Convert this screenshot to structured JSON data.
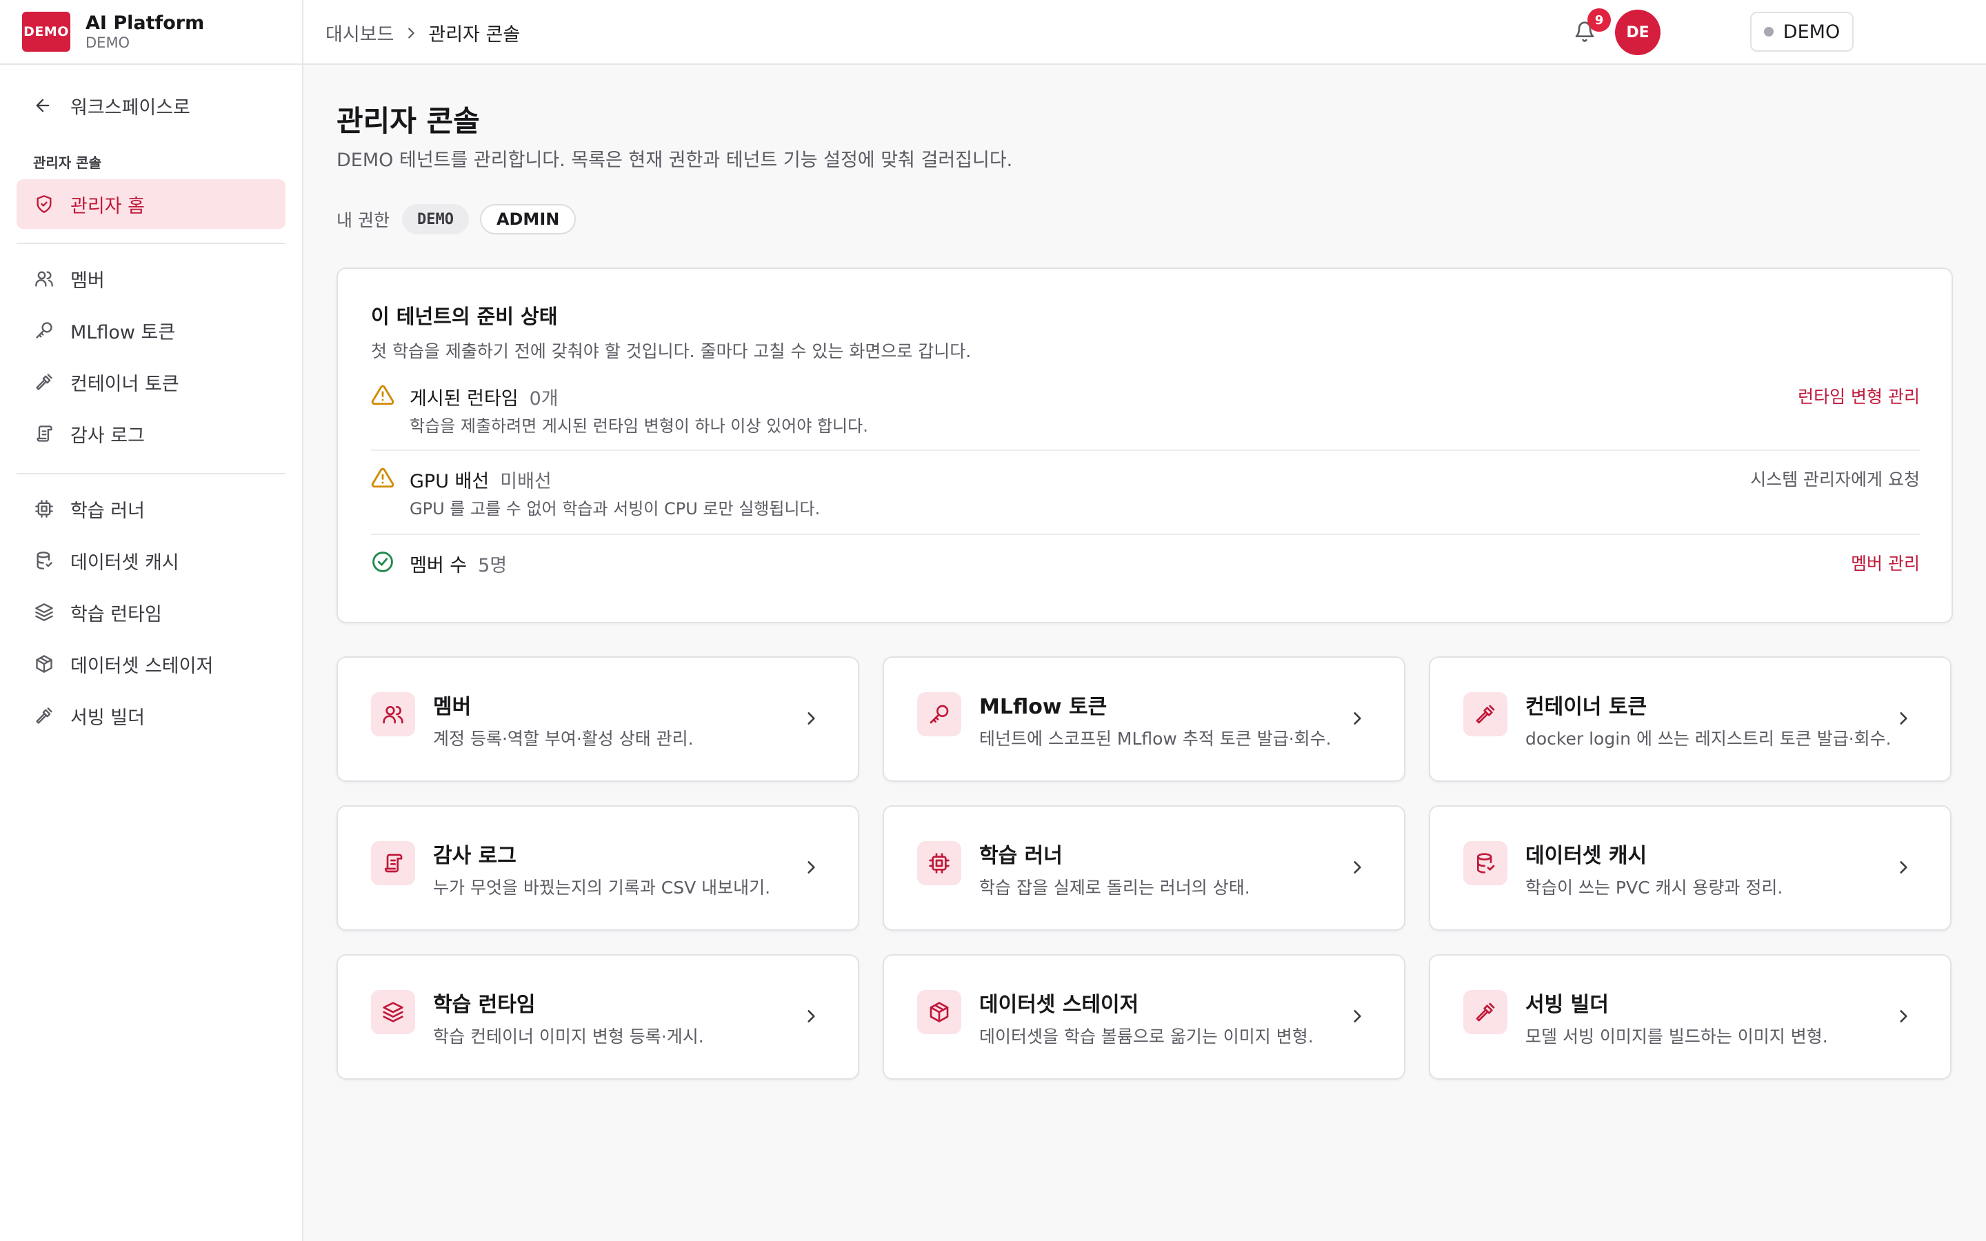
{
  "brand": {
    "logo": "DEMO",
    "name": "AI Platform",
    "tenant": "DEMO"
  },
  "sidebar": {
    "back_label": "워크스페이스로",
    "section_label": "관리자 콘솔",
    "items": [
      {
        "label": "관리자 홈",
        "icon": "shield-icon"
      },
      {
        "label": "멤버",
        "icon": "users-icon"
      },
      {
        "label": "MLflow 토큰",
        "icon": "key-icon"
      },
      {
        "label": "컨테이너 토큰",
        "icon": "hammer-icon"
      },
      {
        "label": "감사 로그",
        "icon": "scroll-icon"
      },
      {
        "label": "학습 러너",
        "icon": "cpu-icon"
      },
      {
        "label": "데이터셋 캐시",
        "icon": "database-icon"
      },
      {
        "label": "학습 런타임",
        "icon": "layers-icon"
      },
      {
        "label": "데이터셋 스테이저",
        "icon": "box-icon"
      },
      {
        "label": "서빙 빌더",
        "icon": "hammer-icon"
      }
    ]
  },
  "header": {
    "breadcrumb": [
      "대시보드",
      "관리자 콘솔"
    ],
    "tenant_chip": "DEMO",
    "notification_count": "9",
    "avatar_initials": "DE"
  },
  "main": {
    "title": "관리자 콘솔",
    "description": "DEMO 테넌트를 관리합니다. 목록은 현재 권한과 테넌트 기능 설정에 맞춰 걸러집니다.",
    "permissions_label": "내 권한",
    "permissions": [
      "DEMO",
      "ADMIN"
    ],
    "readiness": {
      "title": "이 테넌트의 준비 상태",
      "description": "첫 학습을 제출하기 전에 갖춰야 할 것입니다. 줄마다 고칠 수 있는 화면으로 갑니다.",
      "items": [
        {
          "status": "warning",
          "label": "게시된 런타임",
          "value": "0개",
          "sub": "학습을 제출하려면 게시된 런타임 변형이 하나 이상 있어야 합니다.",
          "action": "런타임 변형 관리"
        },
        {
          "status": "warning",
          "label": "GPU 배선",
          "value": "미배선",
          "sub": "GPU 를 고를 수 없어 학습과 서빙이 CPU 로만 실행됩니다.",
          "action": "시스템 관리자에게 요청"
        },
        {
          "status": "ok",
          "label": "멤버 수",
          "value": "5명",
          "sub": "",
          "action": "멤버 관리"
        }
      ],
      "colors": {
        "warning": "#d18a00",
        "ok": "#1f8a4c",
        "accent": "#c0183a"
      }
    },
    "cards": [
      {
        "title": "멤버",
        "desc": "계정 등록·역할 부여·활성 상태 관리.",
        "icon": "users-icon"
      },
      {
        "title": "MLflow 토큰",
        "desc": "테넌트에 스코프된 MLflow 추적 토큰 발급·회수.",
        "icon": "key-icon"
      },
      {
        "title": "컨테이너 토큰",
        "desc": "docker login 에 쓰는 레지스트리 토큰 발급·회수.",
        "icon": "hammer-icon"
      },
      {
        "title": "감사 로그",
        "desc": "누가 무엇을 바꿨는지의 기록과 CSV 내보내기.",
        "icon": "scroll-icon"
      },
      {
        "title": "학습 러너",
        "desc": "학습 잡을 실제로 돌리는 러너의 상태.",
        "icon": "cpu-icon"
      },
      {
        "title": "데이터셋 캐시",
        "desc": "학습이 쓰는 PVC 캐시 용량과 정리.",
        "icon": "database-icon"
      },
      {
        "title": "학습 런타임",
        "desc": "학습 컨테이너 이미지 변형 등록·게시.",
        "icon": "layers-icon"
      },
      {
        "title": "데이터셋 스테이저",
        "desc": "데이터셋을 학습 볼륨으로 옮기는 이미지 변형.",
        "icon": "box-icon"
      },
      {
        "title": "서빙 빌더",
        "desc": "모델 서빙 이미지를 빌드하는 이미지 변형.",
        "icon": "hammer-icon"
      }
    ]
  }
}
